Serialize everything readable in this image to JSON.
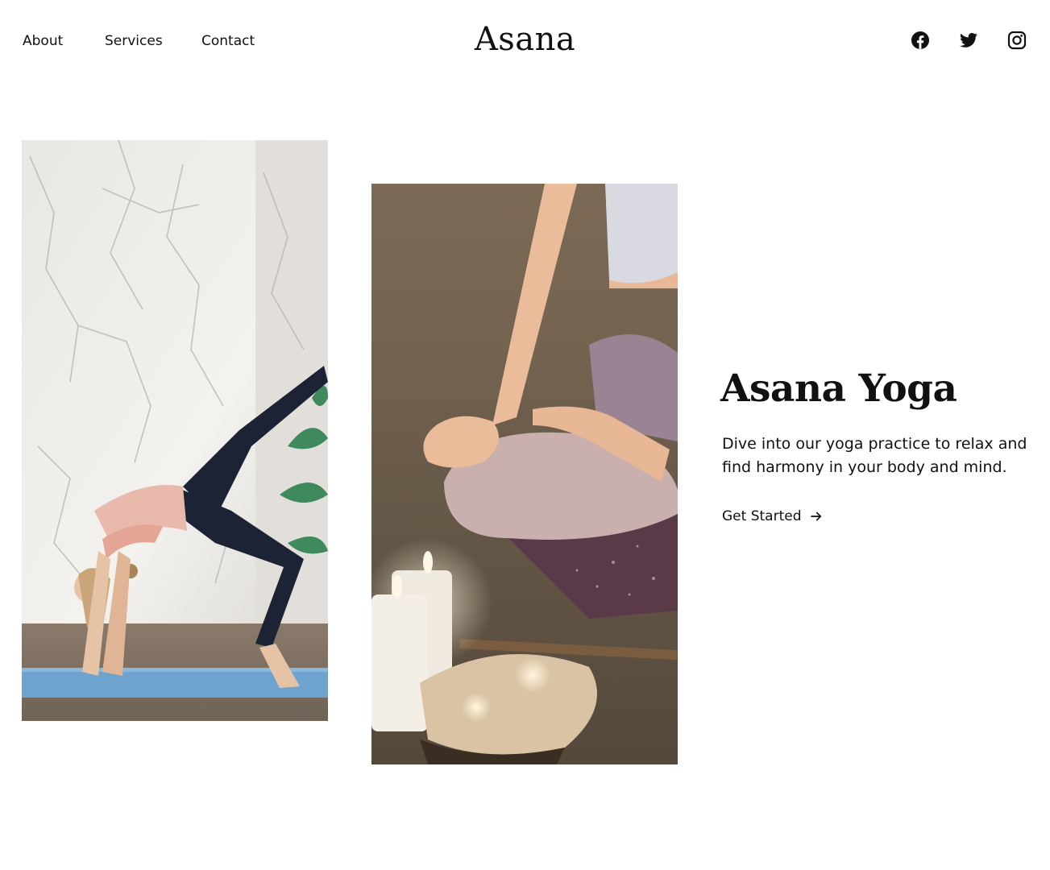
{
  "header": {
    "nav": [
      {
        "label": "About"
      },
      {
        "label": "Services"
      },
      {
        "label": "Contact"
      }
    ],
    "logo": "Asana",
    "social": [
      {
        "icon": "facebook-icon"
      },
      {
        "icon": "twitter-icon"
      },
      {
        "icon": "instagram-icon"
      }
    ]
  },
  "hero": {
    "title": "Asana Yoga",
    "description": "Dive into our yoga practice to relax and find harmony in your body and mind.",
    "cta_label": "Get Started",
    "cta_icon": "arrow-right-icon"
  },
  "images": [
    {
      "subject": "woman in wheel pose on a blue mat"
    },
    {
      "subject": "seated meditation with candles"
    }
  ],
  "colors": {
    "text": "#111111",
    "background": "#ffffff"
  }
}
